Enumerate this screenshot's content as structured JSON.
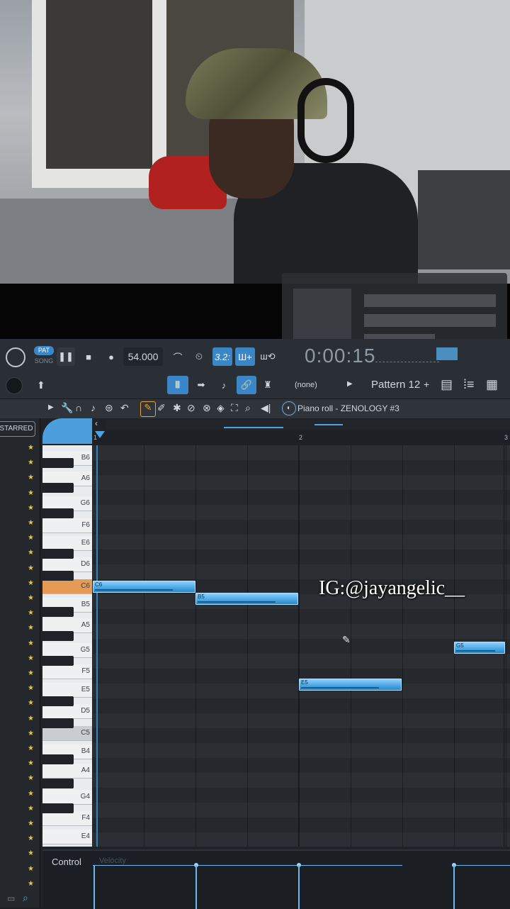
{
  "overlay_text": "IG:@jayangelic__",
  "transport": {
    "pat_label": "PAT",
    "song_label": "SONG",
    "tempo": "54.000",
    "time_display": "0:00:15",
    "snap_value": "3.2:"
  },
  "tools": {
    "channel_selector": "(none)",
    "pattern": "Pattern 12"
  },
  "piano_roll": {
    "title": "Piano roll - ZENOLOGY #3",
    "starred_label": "STARRED",
    "timeline_markers": [
      "1",
      "2",
      "3"
    ],
    "key_labels": [
      "B6",
      "A6",
      "G6",
      "F6",
      "E6",
      "D6",
      "C6",
      "B5",
      "A5",
      "G5",
      "F5",
      "E5",
      "D5",
      "C5",
      "B4",
      "A4",
      "G4",
      "F4",
      "E4"
    ],
    "notes": [
      {
        "label": "C6"
      },
      {
        "label": "B5"
      },
      {
        "label": "G5"
      },
      {
        "label": "E5"
      }
    ],
    "control_label": "Control",
    "control_value": "Velocity"
  },
  "colors": {
    "accent": "#3b86c7",
    "note": "#4aa6e3",
    "highlight_key": "#e59a55",
    "star": "#e7c440"
  }
}
